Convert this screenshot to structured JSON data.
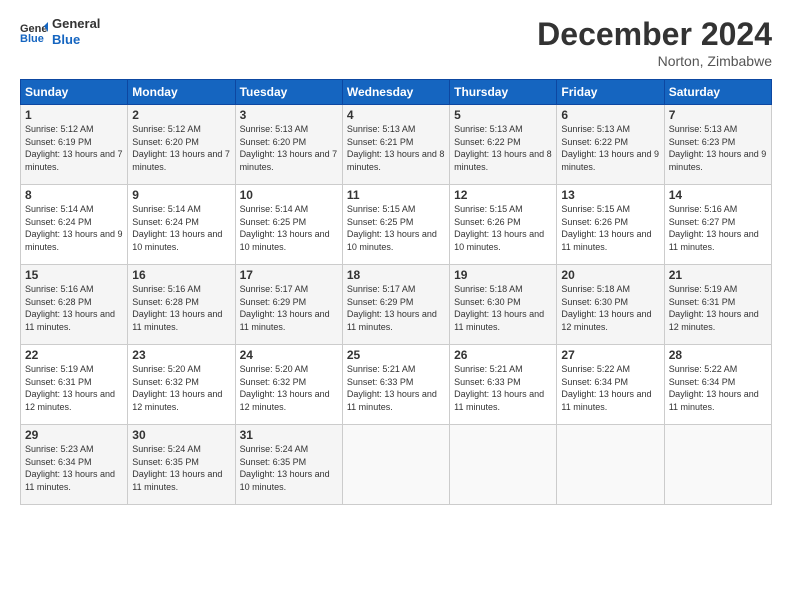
{
  "header": {
    "logo_general": "General",
    "logo_blue": "Blue",
    "month_title": "December 2024",
    "location": "Norton, Zimbabwe"
  },
  "weekdays": [
    "Sunday",
    "Monday",
    "Tuesday",
    "Wednesday",
    "Thursday",
    "Friday",
    "Saturday"
  ],
  "weeks": [
    [
      {
        "day": "1",
        "sunrise": "5:12 AM",
        "sunset": "6:19 PM",
        "daylight": "13 hours and 7 minutes."
      },
      {
        "day": "2",
        "sunrise": "5:12 AM",
        "sunset": "6:20 PM",
        "daylight": "13 hours and 7 minutes."
      },
      {
        "day": "3",
        "sunrise": "5:13 AM",
        "sunset": "6:20 PM",
        "daylight": "13 hours and 7 minutes."
      },
      {
        "day": "4",
        "sunrise": "5:13 AM",
        "sunset": "6:21 PM",
        "daylight": "13 hours and 8 minutes."
      },
      {
        "day": "5",
        "sunrise": "5:13 AM",
        "sunset": "6:22 PM",
        "daylight": "13 hours and 8 minutes."
      },
      {
        "day": "6",
        "sunrise": "5:13 AM",
        "sunset": "6:22 PM",
        "daylight": "13 hours and 9 minutes."
      },
      {
        "day": "7",
        "sunrise": "5:13 AM",
        "sunset": "6:23 PM",
        "daylight": "13 hours and 9 minutes."
      }
    ],
    [
      {
        "day": "8",
        "sunrise": "5:14 AM",
        "sunset": "6:24 PM",
        "daylight": "13 hours and 9 minutes."
      },
      {
        "day": "9",
        "sunrise": "5:14 AM",
        "sunset": "6:24 PM",
        "daylight": "13 hours and 10 minutes."
      },
      {
        "day": "10",
        "sunrise": "5:14 AM",
        "sunset": "6:25 PM",
        "daylight": "13 hours and 10 minutes."
      },
      {
        "day": "11",
        "sunrise": "5:15 AM",
        "sunset": "6:25 PM",
        "daylight": "13 hours and 10 minutes."
      },
      {
        "day": "12",
        "sunrise": "5:15 AM",
        "sunset": "6:26 PM",
        "daylight": "13 hours and 10 minutes."
      },
      {
        "day": "13",
        "sunrise": "5:15 AM",
        "sunset": "6:26 PM",
        "daylight": "13 hours and 11 minutes."
      },
      {
        "day": "14",
        "sunrise": "5:16 AM",
        "sunset": "6:27 PM",
        "daylight": "13 hours and 11 minutes."
      }
    ],
    [
      {
        "day": "15",
        "sunrise": "5:16 AM",
        "sunset": "6:28 PM",
        "daylight": "13 hours and 11 minutes."
      },
      {
        "day": "16",
        "sunrise": "5:16 AM",
        "sunset": "6:28 PM",
        "daylight": "13 hours and 11 minutes."
      },
      {
        "day": "17",
        "sunrise": "5:17 AM",
        "sunset": "6:29 PM",
        "daylight": "13 hours and 11 minutes."
      },
      {
        "day": "18",
        "sunrise": "5:17 AM",
        "sunset": "6:29 PM",
        "daylight": "13 hours and 11 minutes."
      },
      {
        "day": "19",
        "sunrise": "5:18 AM",
        "sunset": "6:30 PM",
        "daylight": "13 hours and 11 minutes."
      },
      {
        "day": "20",
        "sunrise": "5:18 AM",
        "sunset": "6:30 PM",
        "daylight": "13 hours and 12 minutes."
      },
      {
        "day": "21",
        "sunrise": "5:19 AM",
        "sunset": "6:31 PM",
        "daylight": "13 hours and 12 minutes."
      }
    ],
    [
      {
        "day": "22",
        "sunrise": "5:19 AM",
        "sunset": "6:31 PM",
        "daylight": "13 hours and 12 minutes."
      },
      {
        "day": "23",
        "sunrise": "5:20 AM",
        "sunset": "6:32 PM",
        "daylight": "13 hours and 12 minutes."
      },
      {
        "day": "24",
        "sunrise": "5:20 AM",
        "sunset": "6:32 PM",
        "daylight": "13 hours and 12 minutes."
      },
      {
        "day": "25",
        "sunrise": "5:21 AM",
        "sunset": "6:33 PM",
        "daylight": "13 hours and 11 minutes."
      },
      {
        "day": "26",
        "sunrise": "5:21 AM",
        "sunset": "6:33 PM",
        "daylight": "13 hours and 11 minutes."
      },
      {
        "day": "27",
        "sunrise": "5:22 AM",
        "sunset": "6:34 PM",
        "daylight": "13 hours and 11 minutes."
      },
      {
        "day": "28",
        "sunrise": "5:22 AM",
        "sunset": "6:34 PM",
        "daylight": "13 hours and 11 minutes."
      }
    ],
    [
      {
        "day": "29",
        "sunrise": "5:23 AM",
        "sunset": "6:34 PM",
        "daylight": "13 hours and 11 minutes."
      },
      {
        "day": "30",
        "sunrise": "5:24 AM",
        "sunset": "6:35 PM",
        "daylight": "13 hours and 11 minutes."
      },
      {
        "day": "31",
        "sunrise": "5:24 AM",
        "sunset": "6:35 PM",
        "daylight": "13 hours and 10 minutes."
      },
      null,
      null,
      null,
      null
    ]
  ]
}
